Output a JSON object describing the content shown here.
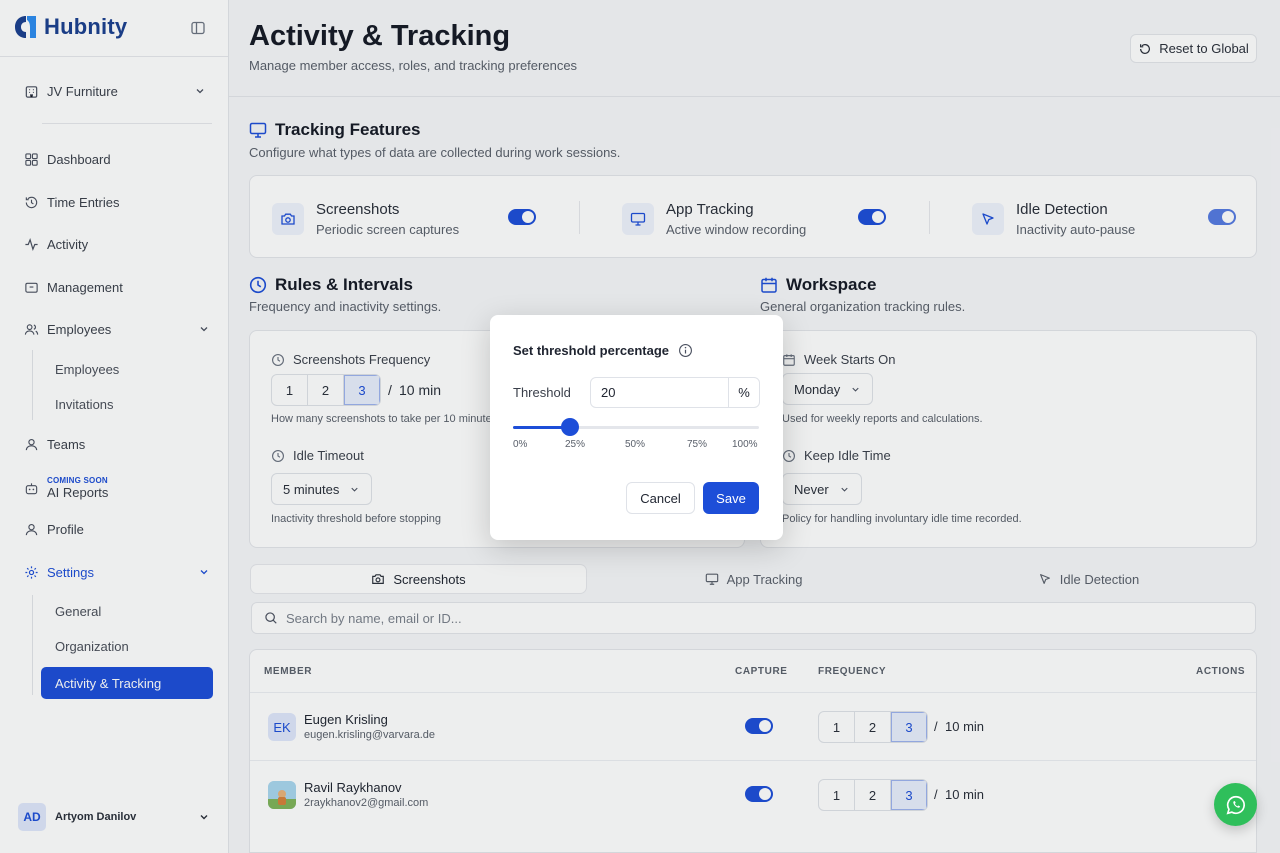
{
  "app": {
    "name": "Hubnity"
  },
  "sidebar": {
    "org": "JV Furniture",
    "nav": {
      "dashboard": "Dashboard",
      "time_entries": "Time Entries",
      "activity": "Activity",
      "management": "Management",
      "employees": "Employees",
      "employees_sub": [
        "Employees",
        "Invitations"
      ],
      "teams": "Teams",
      "ai_reports": "AI Reports",
      "coming_soon": "COMING SOON",
      "profile": "Profile",
      "settings": "Settings",
      "settings_sub": [
        "General",
        "Organization",
        "Activity & Tracking"
      ]
    },
    "user": {
      "initials": "AD",
      "name": "Artyom Danilov"
    }
  },
  "header": {
    "title": "Activity & Tracking",
    "subtitle": "Manage member access, roles, and tracking preferences",
    "reset_label": "Reset to Global"
  },
  "features": {
    "title": "Tracking Features",
    "subtitle": "Configure what types of data are collected during work sessions.",
    "items": [
      {
        "name": "Screenshots",
        "desc": "Periodic screen captures",
        "enabled": true
      },
      {
        "name": "App Tracking",
        "desc": "Active window recording",
        "enabled": true
      },
      {
        "name": "Idle Detection",
        "desc": "Inactivity auto-pause",
        "enabled": true
      }
    ]
  },
  "rules": {
    "title": "Rules & Intervals",
    "subtitle": "Frequency and inactivity settings.",
    "screenshots_frequency": {
      "label": "Screenshots Frequency",
      "options": [
        "1",
        "2",
        "3"
      ],
      "selected": "3",
      "per": "10 min",
      "hint": "How many screenshots to take per 10 minute"
    },
    "idle_timeout": {
      "label": "Idle Timeout",
      "value": "5 minutes",
      "hint": "Inactivity threshold before stopping"
    }
  },
  "workspace": {
    "title": "Workspace",
    "subtitle": "General organization tracking rules.",
    "week_starts": {
      "label": "Week Starts On",
      "value": "Monday",
      "hint": "Used for weekly reports and calculations."
    },
    "keep_idle": {
      "label": "Keep Idle Time",
      "value": "Never",
      "hint": "Policy for handling involuntary idle time recorded."
    }
  },
  "tabs": [
    "Screenshots",
    "App Tracking",
    "Idle Detection"
  ],
  "search": {
    "placeholder": "Search by name, email or ID..."
  },
  "table": {
    "headers": {
      "member": "MEMBER",
      "capture": "CAPTURE",
      "frequency": "FREQUENCY",
      "actions": "ACTIONS"
    },
    "rows": [
      {
        "initials": "EK",
        "name": "Eugen Krisling",
        "email": "eugen.krisling@varvara.de",
        "capture": true,
        "options": [
          "1",
          "2",
          "3"
        ],
        "selected": "3",
        "per": "10 min"
      },
      {
        "initials": "",
        "name": "Ravil Raykhanov",
        "email": "2raykhanov2@gmail.com",
        "capture": true,
        "options": [
          "1",
          "2",
          "3"
        ],
        "selected": "3",
        "per": "10 min"
      }
    ]
  },
  "modal": {
    "title": "Set threshold percentage",
    "field_label": "Threshold",
    "value": "20",
    "unit": "%",
    "slider_value": 0.23,
    "ticks": [
      "0%",
      "25%",
      "50%",
      "75%",
      "100%"
    ],
    "cancel": "Cancel",
    "save": "Save"
  },
  "colors": {
    "accent": "#1d4ed8",
    "chat": "#2fbf5b"
  }
}
